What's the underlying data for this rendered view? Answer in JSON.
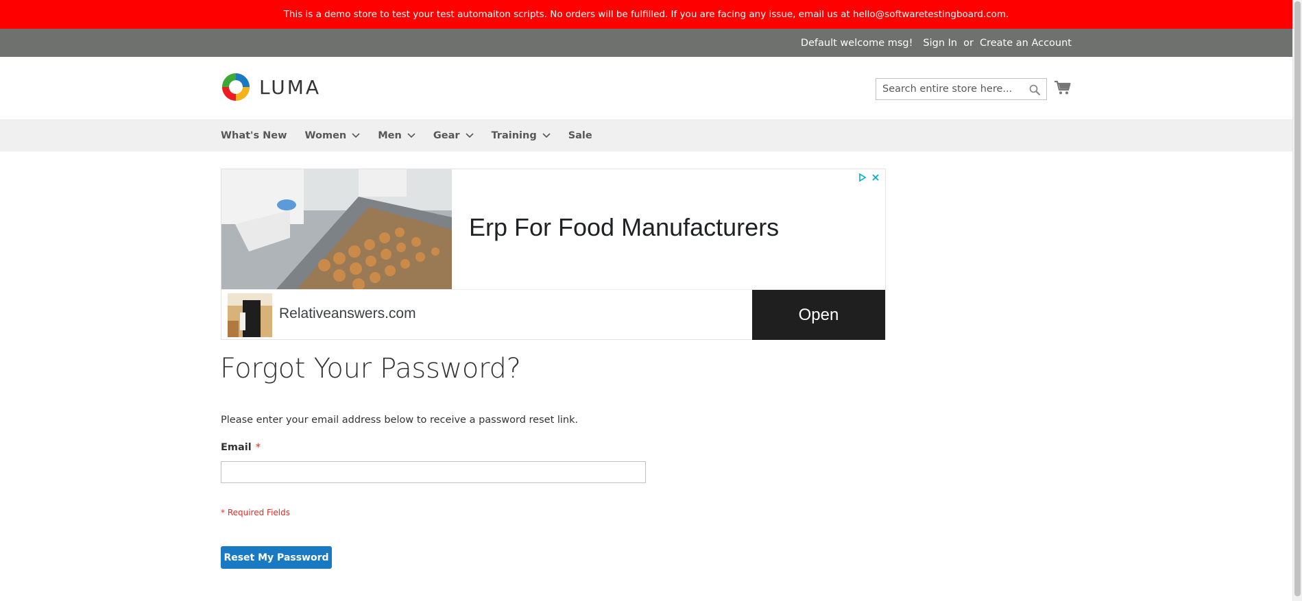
{
  "banner": {
    "text": "This is a demo store to test your test automaiton scripts. No orders will be fulfilled. If you are facing any issue, email us at hello@softwaretestingboard.com."
  },
  "header": {
    "welcome": "Default welcome msg!",
    "sign_in": "Sign In",
    "or": "or",
    "create_account": "Create an Account"
  },
  "logo": {
    "text": "LUMA"
  },
  "search": {
    "placeholder": "Search entire store here...",
    "icon": "search-icon"
  },
  "cart": {
    "icon": "cart-icon"
  },
  "nav": {
    "items": [
      {
        "label": "What's New",
        "dropdown": false
      },
      {
        "label": "Women",
        "dropdown": true
      },
      {
        "label": "Men",
        "dropdown": true
      },
      {
        "label": "Gear",
        "dropdown": true
      },
      {
        "label": "Training",
        "dropdown": true
      },
      {
        "label": "Sale",
        "dropdown": false
      }
    ]
  },
  "ad": {
    "headline": "Erp For Food Manufacturers",
    "advertiser": "Relativeanswers.com",
    "cta": "Open"
  },
  "main": {
    "title": "Forgot Your Password?",
    "intro": "Please enter your email address below to receive a password reset link.",
    "email_label": "Email",
    "required_marker": "*",
    "email_value": "",
    "required_note": "* Required Fields",
    "submit": "Reset My Password"
  },
  "colors": {
    "banner_bg": "#ff0000",
    "header_bg": "#6e716e",
    "nav_bg": "#f0f0f0",
    "primary_button": "#1979c3",
    "required": "#e02b27"
  }
}
